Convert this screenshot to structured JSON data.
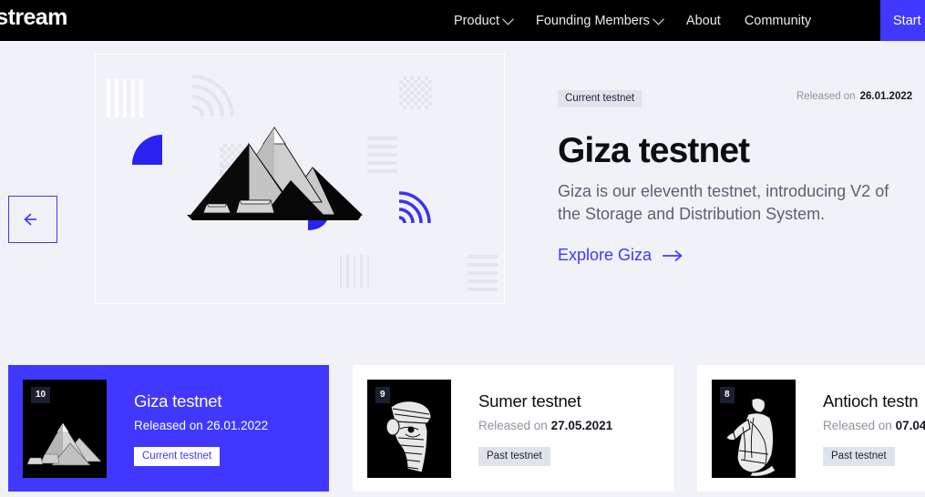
{
  "colors": {
    "brand_blue": "#4038ff",
    "page_bg": "#f0f2f8",
    "header_bg": "#000000",
    "badge_bg": "#dfe3ec",
    "muted_text": "#8d93a3"
  },
  "header": {
    "logo_text": "ystream",
    "nav": [
      {
        "label": "Product",
        "has_dropdown": true
      },
      {
        "label": "Founding Members",
        "has_dropdown": true
      },
      {
        "label": "About",
        "has_dropdown": false
      },
      {
        "label": "Community",
        "has_dropdown": false
      }
    ],
    "cta_label": "Start e"
  },
  "hero": {
    "prev_icon": "arrow-left-icon",
    "badge": "Current testnet",
    "released_label": "Released on",
    "released_date": "26.01.2022",
    "title": "Giza testnet",
    "description": "Giza is our eleventh testnet, introducing V2 of the Storage and Distribution System.",
    "link_label": "Explore Giza",
    "link_icon": "arrow-right-icon",
    "illustration": "pyramids-of-giza-illustration"
  },
  "cards": [
    {
      "number": "10",
      "title": "Giza testnet",
      "released_label": "Released on",
      "released_date": "26.01.2022",
      "status": "Current testnet",
      "active": true,
      "thumb_icon": "pyramids-thumbnail"
    },
    {
      "number": "9",
      "title": "Sumer testnet",
      "released_label": "Released on",
      "released_date": "27.05.2021",
      "status": "Past testnet",
      "active": false,
      "thumb_icon": "sumerian-head-thumbnail"
    },
    {
      "number": "8",
      "title": "Antioch testn",
      "released_label": "Released on",
      "released_date": "07.04",
      "status": "Past testnet",
      "active": false,
      "thumb_icon": "roman-statue-thumbnail"
    }
  ]
}
